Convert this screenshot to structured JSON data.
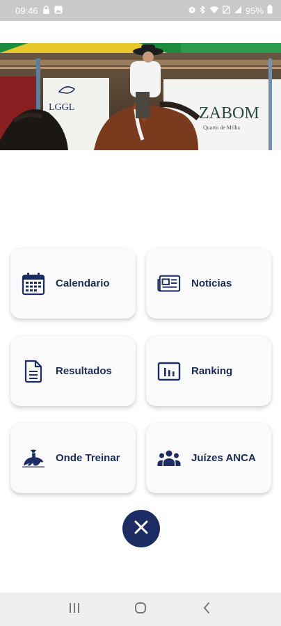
{
  "status_bar": {
    "time": "09:46",
    "battery": "95%",
    "icons": [
      "lock-icon",
      "image-icon",
      "alarm-icon",
      "bluetooth-icon",
      "wifi-icon",
      "no-sim-icon",
      "signal-icon",
      "battery-icon"
    ]
  },
  "hero": {
    "banner_texts": [
      "LGGL",
      "ZABOM",
      "Quarto de Milha"
    ]
  },
  "menu": [
    {
      "label": "Calendario",
      "icon": "calendar-icon"
    },
    {
      "label": "Noticias",
      "icon": "newspaper-icon"
    },
    {
      "label": "Resultados",
      "icon": "document-icon"
    },
    {
      "label": "Ranking",
      "icon": "bar-chart-icon"
    },
    {
      "label": "Onde Treinar",
      "icon": "horse-rider-icon"
    },
    {
      "label": "Juízes ANCA",
      "icon": "group-icon"
    }
  ],
  "colors": {
    "accent": "#1b2d63",
    "label": "#1c2b5a",
    "status_bar": "#c9c9c9",
    "nav_bar": "#efefef"
  },
  "navigation": {
    "buttons": [
      "recent-apps-icon",
      "home-icon",
      "back-icon"
    ]
  }
}
